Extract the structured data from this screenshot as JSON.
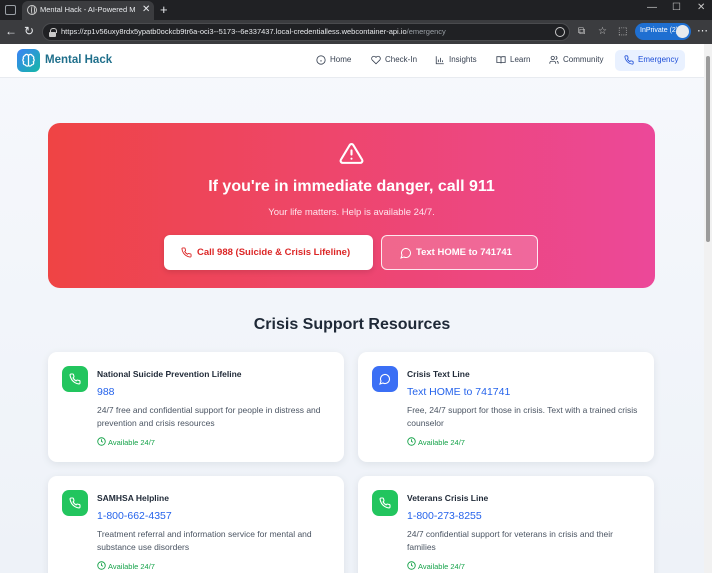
{
  "browser": {
    "tab_title": "Mental Hack - AI-Powered Mental",
    "url_host": "https://zp1v56uxy8rdx5ypatb0ockcb9tr6a-oci3--5173--6e337437.local-credentialless.webcontainer-api.io",
    "url_path": "/emergency",
    "inprivate_label": "InPrivate (2)"
  },
  "app": {
    "brand": "Mental Hack",
    "nav": [
      {
        "label": "Home",
        "icon": "info-circle-icon"
      },
      {
        "label": "Check-In",
        "icon": "heart-icon"
      },
      {
        "label": "Insights",
        "icon": "bar-chart-icon"
      },
      {
        "label": "Learn",
        "icon": "book-icon"
      },
      {
        "label": "Community",
        "icon": "users-icon"
      },
      {
        "label": "Emergency",
        "icon": "phone-icon",
        "active": true
      }
    ]
  },
  "hero": {
    "title": "If you're in immediate danger, call 911",
    "subtitle": "Your life matters. Help is available 24/7.",
    "call_button": "Call 988 (Suicide & Crisis Lifeline)",
    "text_button": "Text HOME to 741741"
  },
  "resources": {
    "title": "Crisis Support Resources",
    "items": [
      {
        "name": "National Suicide Prevention Lifeline",
        "contact": "988",
        "description": "24/7 free and confidential support for people in distress and prevention and crisis resources",
        "availability": "Available 24/7",
        "icon": "phone-icon",
        "color": "#22c55e"
      },
      {
        "name": "Crisis Text Line",
        "contact": "Text HOME to 741741",
        "description": "Free, 24/7 support for those in crisis. Text with a trained crisis counselor",
        "availability": "Available 24/7",
        "icon": "message-icon",
        "color": "#3b6ff5"
      },
      {
        "name": "SAMHSA Helpline",
        "contact": "1-800-662-4357",
        "description": "Treatment referral and information service for mental and substance use disorders",
        "availability": "Available 24/7",
        "icon": "phone-icon",
        "color": "#22c55e"
      },
      {
        "name": "Veterans Crisis Line",
        "contact": "1-800-273-8255",
        "description": "24/7 confidential support for veterans in crisis and their families",
        "availability": "Available 24/7",
        "icon": "phone-icon",
        "color": "#22c55e"
      }
    ]
  },
  "colors": {
    "hero_start": "#ef4444",
    "hero_end": "#ec4899",
    "accent": "#2563eb",
    "success": "#16a34a"
  }
}
